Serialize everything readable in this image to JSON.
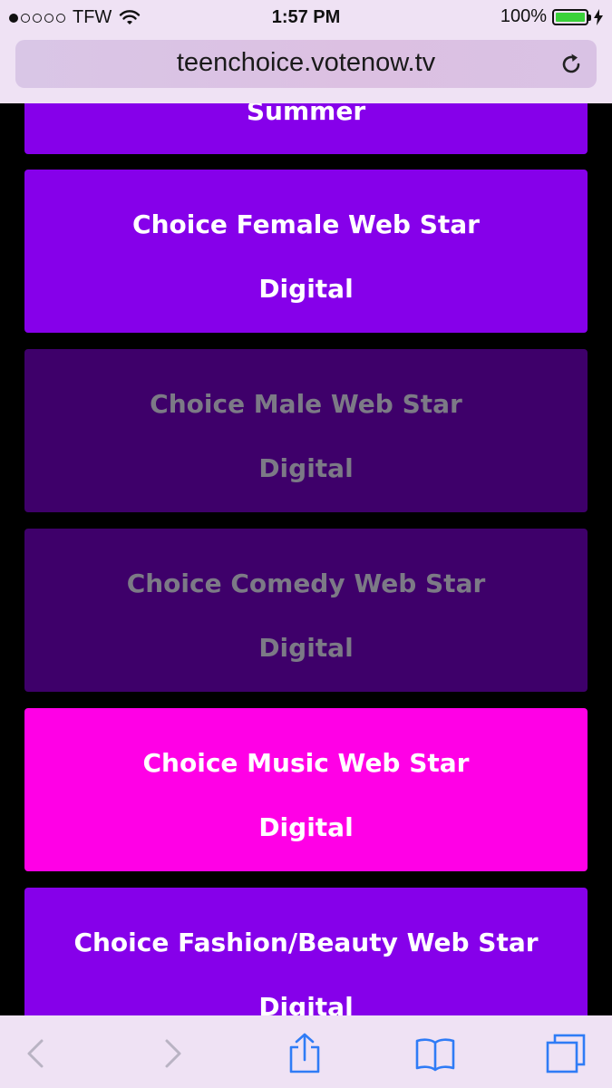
{
  "status_bar": {
    "carrier": "TFW",
    "time": "1:57 PM",
    "battery_percent": "100%",
    "signal_filled": 1,
    "signal_total": 5,
    "battery_color": "#3ad13a"
  },
  "browser": {
    "url": "teenchoice.votenow.tv",
    "reload_icon": "reload-icon"
  },
  "categories": [
    {
      "title": "Summer",
      "subtitle": "",
      "state": "active"
    },
    {
      "title": "Choice Female Web Star",
      "subtitle": "Digital",
      "state": "active"
    },
    {
      "title": "Choice Male Web Star",
      "subtitle": "Digital",
      "state": "disabled"
    },
    {
      "title": "Choice Comedy Web Star",
      "subtitle": "Digital",
      "state": "disabled"
    },
    {
      "title": "Choice Music Web Star",
      "subtitle": "Digital",
      "state": "selected"
    },
    {
      "title": "Choice Fashion/Beauty Web Star",
      "subtitle": "Digital",
      "state": "active"
    }
  ],
  "colors": {
    "active": "#8600ea",
    "disabled": "#3e006a",
    "selected": "#ff00e6",
    "disabled_text": "#7c7a86",
    "chrome": "#efe2f4",
    "toolbar_icon": "#2f7cf6"
  },
  "toolbar": {
    "back_icon": "chevron-left-icon",
    "forward_icon": "chevron-right-icon",
    "share_icon": "share-icon",
    "bookmarks_icon": "book-icon",
    "tabs_icon": "tabs-icon"
  }
}
